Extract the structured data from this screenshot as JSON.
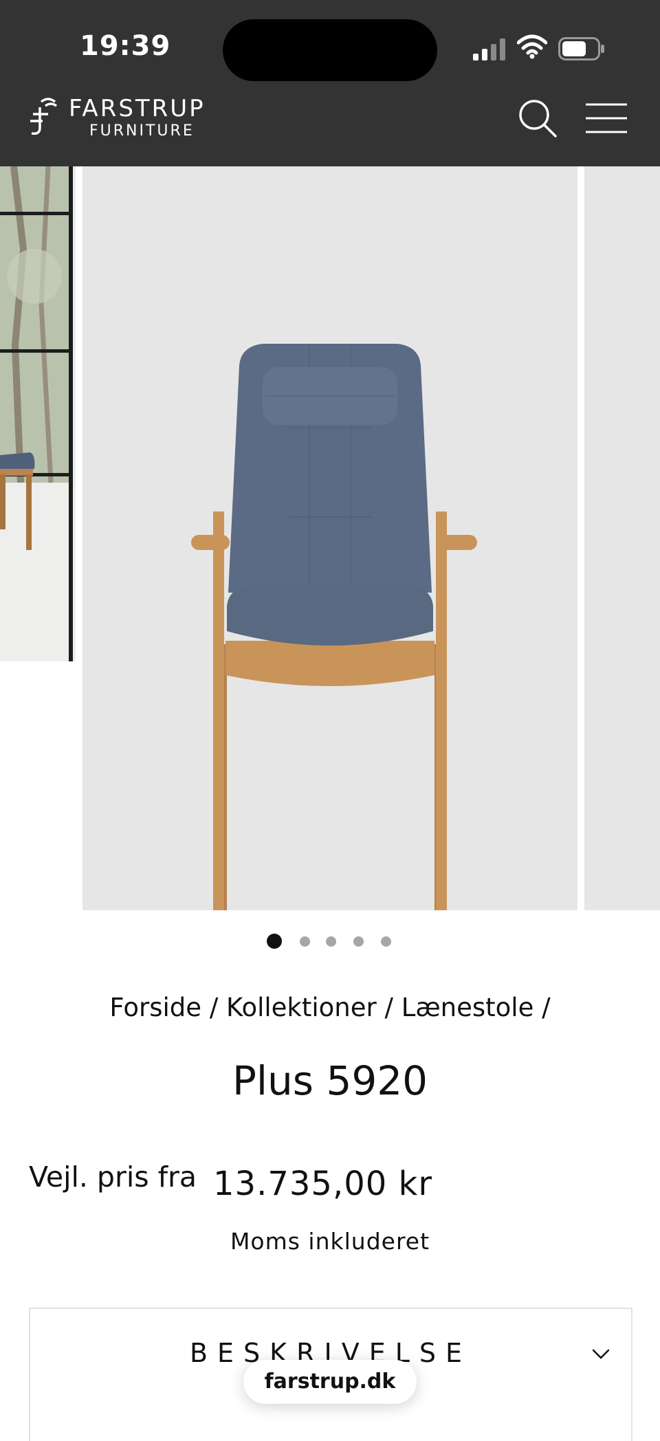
{
  "status_bar": {
    "time": "19:39"
  },
  "brand": {
    "name": "FARSTRUP",
    "subtitle": "FURNITURE"
  },
  "header": {
    "icons": [
      "search-icon",
      "menu-icon"
    ]
  },
  "gallery": {
    "slide_count": 5,
    "active_index": 0,
    "zoom_icon": "zoom-icon"
  },
  "breadcrumb": {
    "items": [
      "Forside",
      "Kollektioner",
      "Lænestole"
    ],
    "separator": "/"
  },
  "product": {
    "title": "Plus 5920",
    "price_label": "Vejl. pris fra",
    "price": "13.735,00 kr",
    "vat_note": "Moms inkluderet"
  },
  "accordion": {
    "label": "BESKRIVELSE",
    "icon": "chevron-down-icon"
  },
  "browser": {
    "url": "farstrup.dk"
  },
  "colors": {
    "header_bg": "#333333",
    "fabric": "#5b6b85",
    "wood": "#c9945a",
    "slide_bg": "#e6e6e6"
  }
}
